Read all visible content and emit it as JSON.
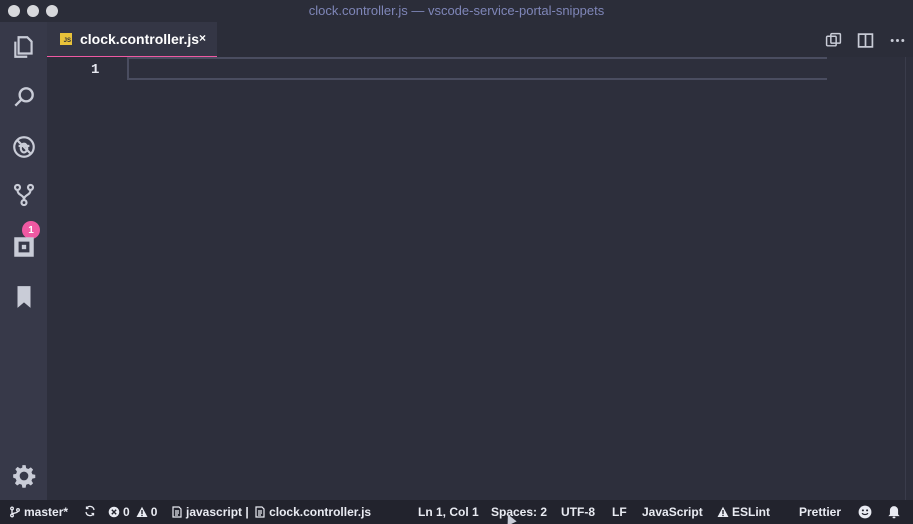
{
  "window": {
    "title": "clock.controller.js — vscode-service-portal-snippets"
  },
  "activity_bar": {
    "items": [
      {
        "name": "explorer-icon"
      },
      {
        "name": "search-icon"
      },
      {
        "name": "debug-icon"
      },
      {
        "name": "source-control-icon",
        "badge": "1"
      },
      {
        "name": "extensions-icon"
      },
      {
        "name": "bookmarks-icon"
      },
      {
        "name": "settings-gear-icon"
      }
    ]
  },
  "tabs": [
    {
      "label": "clock.controller.js",
      "icon": "js-file-icon",
      "icon_text": "JS",
      "close": "×",
      "active": true
    }
  ],
  "tab_actions": [
    "open-changes-icon",
    "split-editor-icon",
    "more-actions-icon"
  ],
  "editor": {
    "line_numbers": [
      "1"
    ]
  },
  "status": {
    "branch": "master*",
    "errors": "0",
    "warnings": "0",
    "language_info": "javascript | ",
    "file": "clock.controller.js",
    "position": "Ln 1, Col 1",
    "spaces": "Spaces: 2",
    "encoding": "UTF-8",
    "eol": "LF",
    "language": "JavaScript",
    "eslint": "ESLint",
    "prettier": "Prettier"
  },
  "colors": {
    "accent": "#ef59a2",
    "title": "#7f86b8",
    "js_icon": "#e8c23a",
    "editor_bg": "#2d2f3c",
    "activity_bg": "#373949",
    "status_bg": "#22232d"
  }
}
